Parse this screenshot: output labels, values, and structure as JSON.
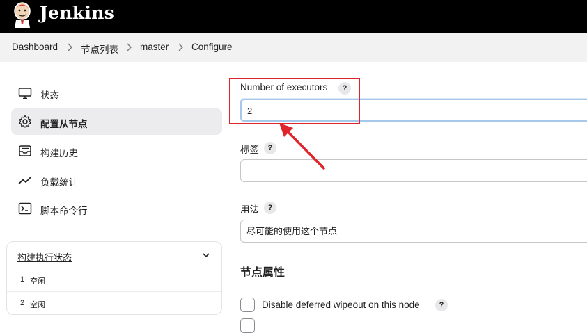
{
  "header": {
    "brand": "Jenkins",
    "logo_icon": "jenkins-butler-logo"
  },
  "breadcrumb": {
    "items": [
      "Dashboard",
      "节点列表",
      "master",
      "Configure"
    ],
    "separator_icon": "chevron-right-icon"
  },
  "sidebar": {
    "items": [
      {
        "label": "状态",
        "icon": "monitor-icon",
        "active": false
      },
      {
        "label": "配置从节点",
        "icon": "gear-icon",
        "active": true
      },
      {
        "label": "构建历史",
        "icon": "inbox-icon",
        "active": false
      },
      {
        "label": "负载统计",
        "icon": "trend-line-icon",
        "active": false
      },
      {
        "label": "脚本命令行",
        "icon": "terminal-icon",
        "active": false
      }
    ],
    "executor_status": {
      "title": "构建执行状态",
      "rows": [
        {
          "num": "1",
          "status": "空闲"
        },
        {
          "num": "2",
          "status": "空闲"
        }
      ]
    }
  },
  "form": {
    "executors": {
      "label": "Number of executors",
      "value": "2",
      "help": "?"
    },
    "labels": {
      "label": "标签",
      "value": "",
      "help": "?"
    },
    "usage": {
      "label": "用法",
      "value": "尽可能的使用这个节点",
      "help": "?"
    },
    "node_properties": {
      "title": "节点属性"
    },
    "deferred_wipeout": {
      "label": "Disable deferred wipeout on this node",
      "checked": false,
      "help": "?"
    }
  },
  "annotation": {
    "color": "#e0242b"
  }
}
